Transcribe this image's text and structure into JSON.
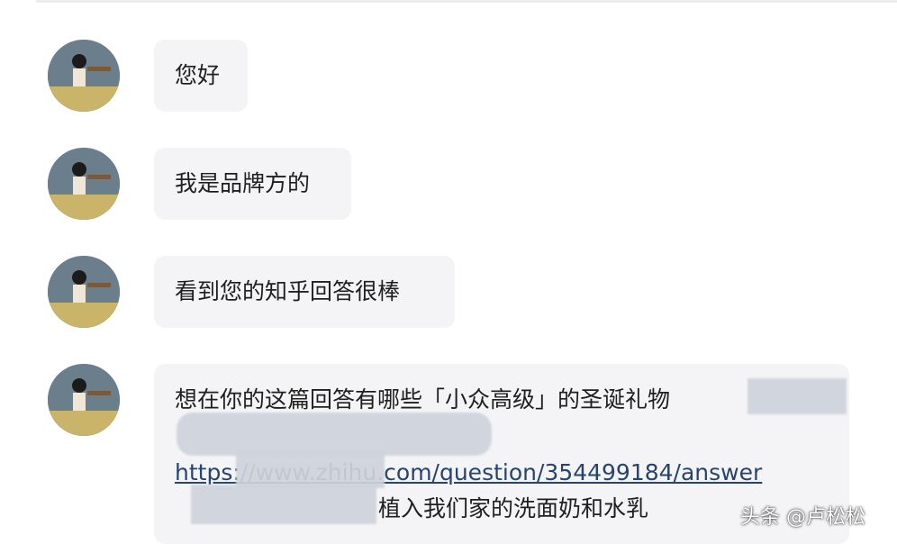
{
  "chat": {
    "messages": [
      {
        "text": "您好"
      },
      {
        "text": "我是品牌方的"
      },
      {
        "text": "看到您的知乎回答很棒"
      },
      {
        "text": "想在你的这篇回答有哪些「小众高级」的圣诞礼物",
        "link_text": "https://www.zhihu.com/question/354499184/answer",
        "tail_text": "植入我们家的洗面奶和水乳"
      }
    ]
  },
  "watermark": {
    "text": "头条 @卢松松"
  },
  "avatar": {
    "icon": "user-avatar-icon",
    "bg_color": "#6b7e8c"
  },
  "colors": {
    "bubble": "#f4f4f6",
    "link": "#25456f",
    "page_bg": "#ffffff"
  }
}
